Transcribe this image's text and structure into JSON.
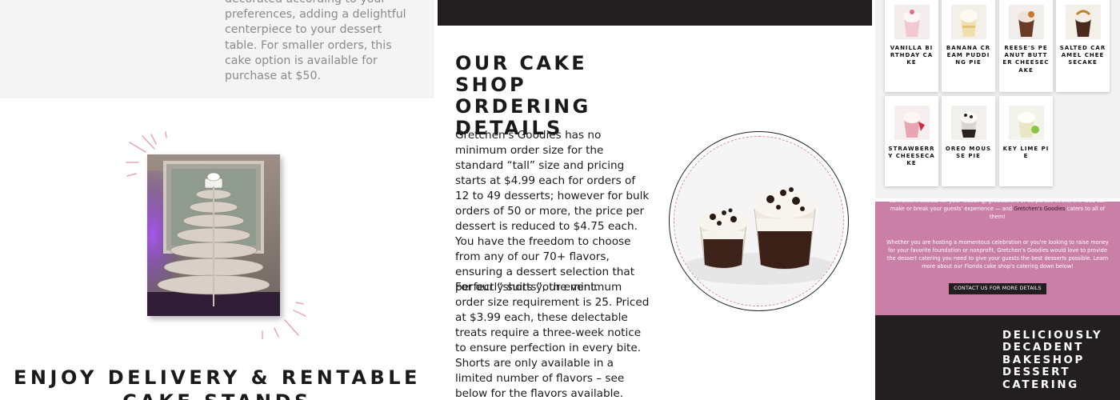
{
  "left_panel": {
    "top_text": "decorated according to your preferences, adding a delightful centerpiece to your dessert table. For smaller orders, this cake option is available for purchase at $50.",
    "heading": "ENJOY DELIVERY & RENTABLE CAKE STANDS"
  },
  "middle_panel": {
    "heading": "OUR CAKE SHOP ORDERING DETAILS",
    "paragraph1": "Gretchen's Goodies has no minimum order size for the standard “tall” size and pricing starts at $4.99 each for orders of 12 to 49 desserts; however for bulk orders of 50 or more, the price per dessert is reduced to $4.75 each. You have the freedom to choose from any of our 70+ flavors, ensuring a dessert selection that perfectly suits your event.",
    "paragraph2": "For our “shorts”, the minimum order size requirement is 25. Priced at $3.99 each, these delectable treats require a three-week notice to ensure perfection in every bite. Shorts are only available in a limited number of flavors – see below for the flavors available."
  },
  "right_panel": {
    "flavors": [
      {
        "label": "VANILLA BIRTHDAY CAKE",
        "icon": "vanilla-birthday-cake-icon"
      },
      {
        "label": "BANANA CREAM PUDDING PIE",
        "icon": "banana-cream-pudding-pie-icon"
      },
      {
        "label": "REESE'S PEANUT BUTTER CHEESECAKE",
        "icon": "reeses-cheesecake-icon"
      },
      {
        "label": "SALTED CARAMEL CHEESECAKE",
        "icon": "salted-caramel-cheesecake-icon"
      },
      {
        "label": "STRAWBERRY CHEESECAKE",
        "icon": "strawberry-cheesecake-icon"
      },
      {
        "label": "OREO MOUSSE PIE",
        "icon": "oreo-mousse-pie-icon"
      },
      {
        "label": "KEY LIME PIE",
        "icon": "key-lime-pie-icon"
      }
    ],
    "pink_text1_before": "convenient sweets for your wedding, graduation, or corporate event, the food can make or break your guests' experience — and ",
    "pink_text1_link": "Gretchen's Goodies",
    "pink_text1_after": " caters to all of them!",
    "pink_text2": "Whether you are hosting a momentous celebration or you're looking to raise money for your favorite foundation or nonprofit, Gretchen's Goodies would love to provide the dessert catering you need to give your guests the best desserts possible. Learn more about our Florida cake shop's catering down below!",
    "contact_button": "CONTACT US FOR MORE DETAILS",
    "dark_heading": "DELICIOUSLY DECADENT BAKESHOP DESSERT CATERING"
  },
  "colors": {
    "pink": "#c97fa6",
    "dark": "#231f20",
    "light_gray": "#f4f4f4"
  }
}
